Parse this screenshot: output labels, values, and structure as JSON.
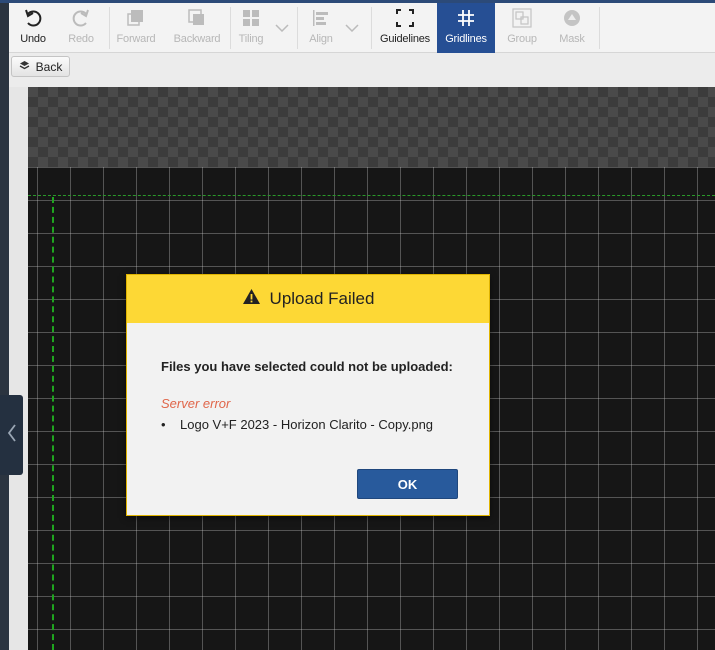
{
  "toolbar": {
    "undo": "Undo",
    "redo": "Redo",
    "forward": "Forward",
    "backward": "Backward",
    "tiling": "Tiling",
    "align": "Align",
    "guidelines": "Guidelines",
    "gridlines": "Gridlines",
    "group": "Group",
    "mask": "Mask"
  },
  "back_button": "Back",
  "dialog": {
    "title": "Upload Failed",
    "message": "Files you have selected could not be uploaded:",
    "error_label": "Server error",
    "files": [
      "Logo V+F 2023 - Horizon Clarito - Copy.png"
    ],
    "ok_label": "OK"
  },
  "colors": {
    "toolbar_active": "#264f94",
    "dialog_header": "#fdd835",
    "error_text": "#e0664a",
    "ok_button": "#285a9c",
    "guideline": "#1fa51f"
  }
}
